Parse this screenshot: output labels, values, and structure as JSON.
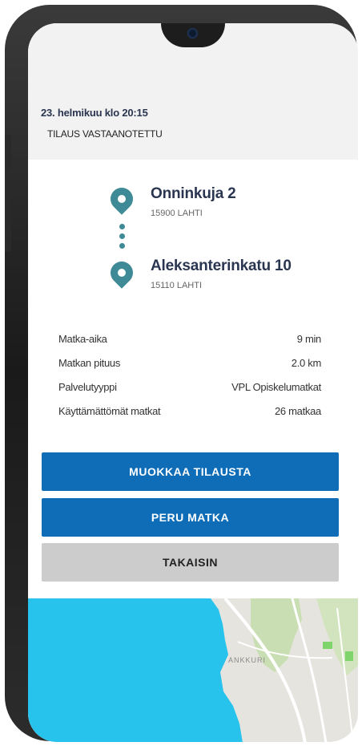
{
  "order": {
    "date": "23. helmikuu  klo 20:15",
    "status": "TILAUS VASTAANOTETTU"
  },
  "route": {
    "from": {
      "street": "Onninkuja  2",
      "postal": "15900  LAHTI"
    },
    "to": {
      "street": "Aleksanterinkatu  10",
      "postal": "15110  LAHTI"
    }
  },
  "details": [
    {
      "label": "Matka-aika",
      "value": "9 min"
    },
    {
      "label": "Matkan pituus",
      "value": "2.0 km"
    },
    {
      "label": "Palvelutyyppi",
      "value": "VPL Opiskelumatkat"
    },
    {
      "label": "Käyttämättömät matkat",
      "value": "26 matkaa"
    }
  ],
  "buttons": {
    "edit": "MUOKKAA TILAUSTA",
    "cancel": "PERU MATKA",
    "back": "TAKAISIN"
  },
  "map": {
    "place_label": "ANKKURI"
  },
  "colors": {
    "primary": "#0f6db8",
    "secondary": "#cccccc",
    "pin": "#3e8a96",
    "title": "#2a3550",
    "water": "#27c3ec"
  }
}
